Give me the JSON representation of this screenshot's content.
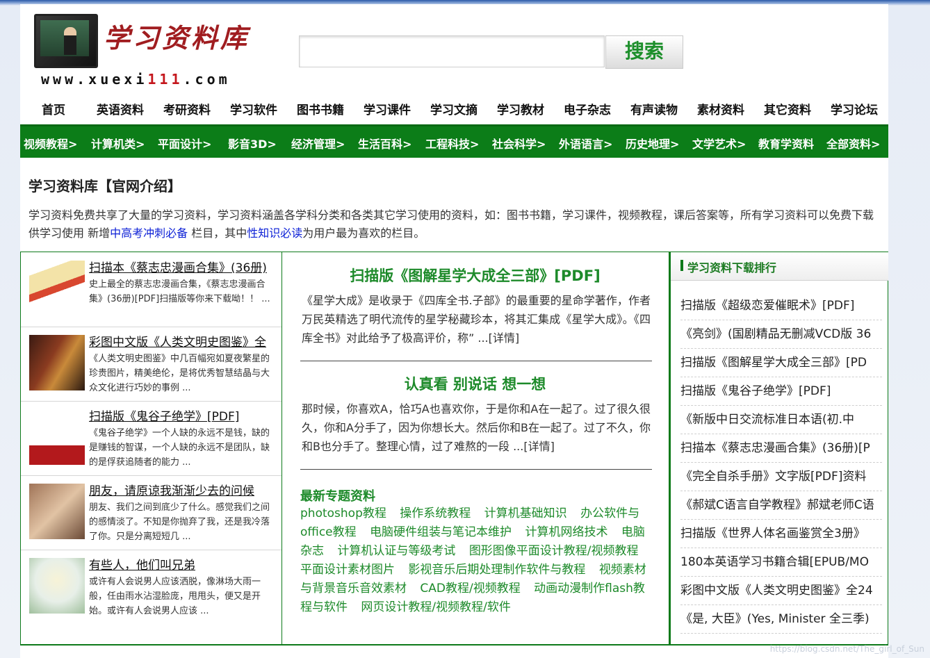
{
  "header": {
    "logo_title": "学习资料库",
    "logo_url_prefix": "www.xuexi",
    "logo_url_highlight": "111",
    "logo_url_suffix": ".com",
    "search_placeholder": "",
    "search_button": "搜索"
  },
  "top_nav": [
    "首页",
    "英语资料",
    "考研资料",
    "学习软件",
    "图书书籍",
    "学习课件",
    "学习文摘",
    "学习教材",
    "电子杂志",
    "有声读物",
    "素材资料",
    "其它资料",
    "学习论坛"
  ],
  "category_bar": [
    "视频教程>",
    "计算机类>",
    "平面设计>",
    "影音3D>",
    "经济管理>",
    "生活百科>",
    "工程科技>",
    "社会科学>",
    "外语语言>",
    "历史地理>",
    "文学艺术>",
    "教育学资料",
    "全部资料>"
  ],
  "intro": {
    "title": "学习资料库【官网介绍】",
    "text_before": "学习资料免费共享了大量的学习资料，学习资料涵盖各学科分类和各类其它学习使用的资料，如：图书书籍，学习课件，视频教程，课后答案等，所有学习资料可以免费下载供学习使用 新增",
    "link1": "中高考冲刺必备",
    "text_middle": " 栏目，其中",
    "link2": "性知识必读",
    "text_after": "为用户最为喜欢的栏目。"
  },
  "left_list": [
    {
      "title": "扫描本《蔡志忠漫画合集》(36册)",
      "desc": "史上最全的蔡志忠漫画合集，《蔡志忠漫画合集》(36册)[PDF]扫描版等你来下载呦！！ ..."
    },
    {
      "title": "彩图中文版《人类文明史图鉴》全",
      "desc": "《人类文明史图鉴》中几百幅宛如夏夜繁星的珍贵图片，精美绝伦，是将优秀智慧结晶与大众文化进行巧妙的事例 ..."
    },
    {
      "title": "扫描版《鬼谷子绝学》[PDF]",
      "desc": "《鬼谷子绝学》一个人缺的永远不是钱，缺的是赚钱的智谋，一个人缺的永远不是团队，缺的是俘获追随者的能力 ..."
    },
    {
      "title": "朋友，请原谅我渐渐少去的问候",
      "desc": "朋友、我们之间到底少了什么。感觉我们之间的感情淡了。不知是你抛弃了我，还是我冷落了你。只是分离短短几 ..."
    },
    {
      "title": "有些人，他们叫兄弟",
      "desc": "或许有人会说男人应该洒脱，像淋场大雨一般，任由雨水沾湿脸庞，甩甩头，便又是开始。或许有人会说男人应该 ..."
    }
  ],
  "middle": {
    "article1_title": "扫描版《图解星学大成全三部》[PDF]",
    "article1_text": "《星学大成》是收录于《四库全书.子部》的最重要的星命学著作，作者万民英精选了明代流传的星学秘藏珍本，将其汇集成《星学大成》。《四库全书》对此给予了极高评价，称” ...[详情]",
    "article2_title": "认真看 别说话 想一想",
    "article2_text": "那时候，你喜欢A，恰巧A也喜欢你，于是你和A在一起了。过了很久很久，你和A分手了，因为你想长大。然后你和B在一起了。过了不久，你和B也分手了。整理心情，过了难熬的一段 ...[详情]",
    "topics_title": "最新专题资料",
    "topics": [
      "photoshop教程",
      "操作系统教程",
      "计算机基础知识",
      "办公软件与office教程",
      "电脑硬件组装与笔记本维护",
      "计算机网络技术",
      "电脑杂志",
      "计算机认证与等级考试",
      "图形图像平面设计教程/视频教程",
      "平面设计素材图片",
      "影视音乐后期处理制作软件与教程",
      "视频素材与背景音乐音效素材",
      "CAD教程/视频教程",
      "动画动漫制作flash教程与软件",
      "网页设计教程/视频教程/软件"
    ]
  },
  "ranking": {
    "title": "学习资料下载排行",
    "items": [
      "扫描版《超级恋爱催眠术》[PDF]",
      "《亮剑》(国剧精品无删减VCD版 36",
      "扫描版《图解星学大成全三部》[PD",
      "扫描版《鬼谷子绝学》[PDF]",
      "《新版中日交流标准日本语(初.中",
      "扫描本《蔡志忠漫画合集》(36册)[P",
      "《完全自杀手册》文字版[PDF]资料",
      "《郝斌C语言自学教程》郝斌老师C语",
      "扫描版《世界人体名画鉴赏全3册》",
      "180本英语学习书籍合辑[EPUB/MO",
      "彩图中文版《人类文明史图鉴》全24",
      "《是, 大臣》(Yes, Minister 全三季)"
    ]
  },
  "watermark": "https://blog.csdn.net/The_girl_of_Sun",
  "colors": {
    "brand_green": "#0c7d18",
    "title_red": "#a01d20",
    "link_blue": "#0b1fd6"
  }
}
